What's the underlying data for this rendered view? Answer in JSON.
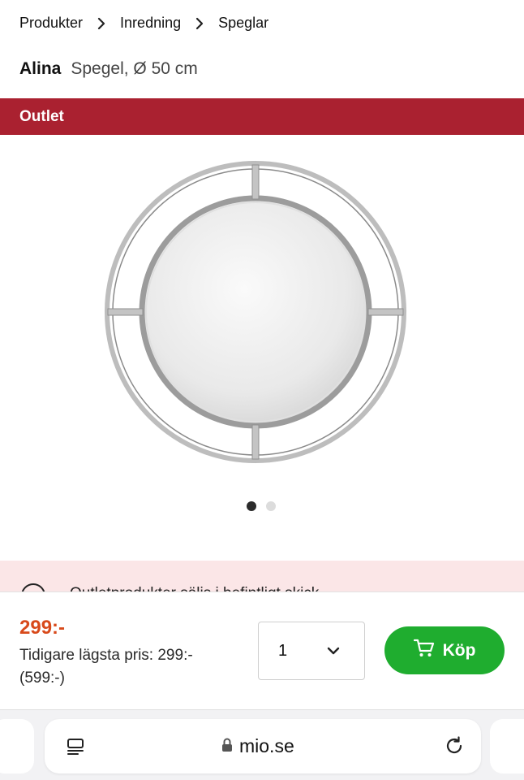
{
  "breadcrumb": {
    "items": [
      "Produkter",
      "Inredning",
      "Speglar"
    ]
  },
  "product": {
    "name": "Alina",
    "subtitle": "Spegel, Ø 50 cm",
    "badge": "Outlet",
    "image_icon": "round-mirror-image",
    "carousel": {
      "total": 2,
      "active": 1
    }
  },
  "notice": {
    "text": "Outletprodukter säljs i befintligt skick",
    "icon": "info-icon"
  },
  "purchase": {
    "price": "299:-",
    "previous_price_line1": "Tidigare lägsta pris: 299:-",
    "previous_price_line2": "(599:-)",
    "quantity": "1",
    "buy_label": "Köp"
  },
  "browser": {
    "url": "mio.se"
  },
  "colors": {
    "outlet_red": "#aa2130",
    "price_orange": "#d84a1b",
    "buy_green": "#1fad2f",
    "notice_pink": "#fbe6e7"
  }
}
